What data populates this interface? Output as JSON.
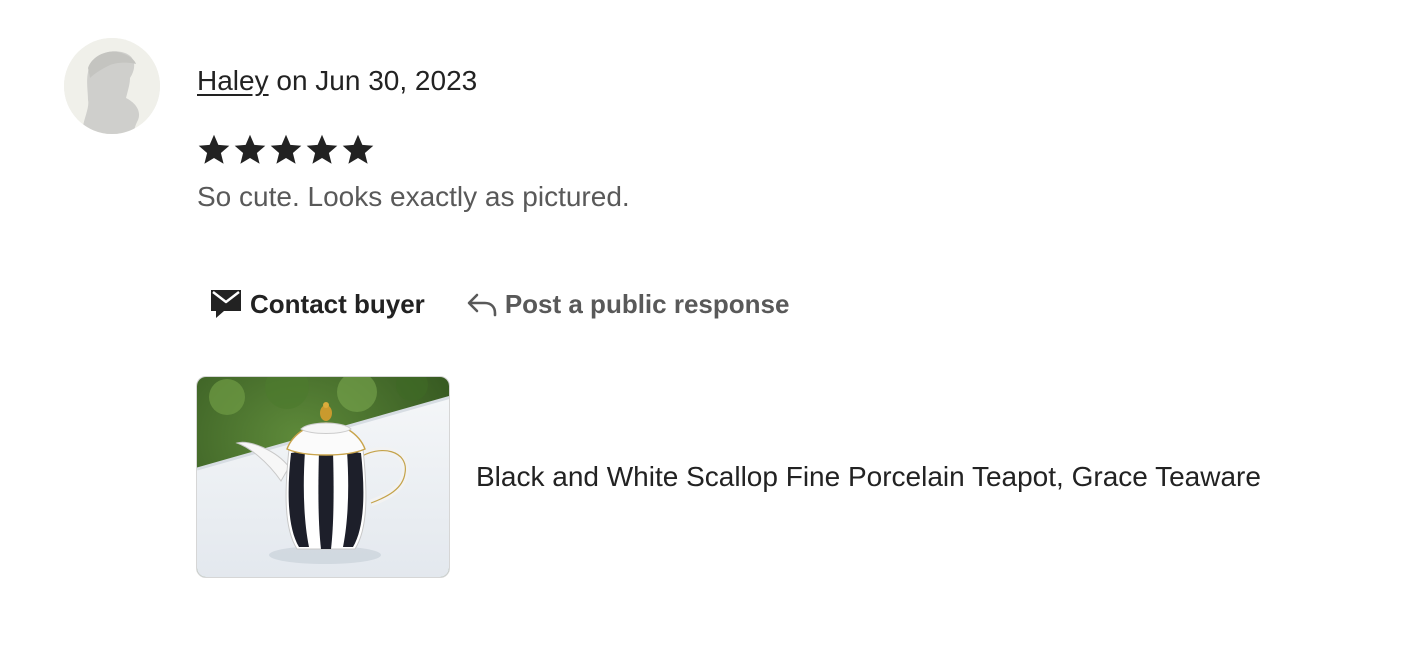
{
  "review": {
    "reviewer_name": "Haley",
    "date_text": "on Jun 30, 2023",
    "rating": 5,
    "rating_max": 5,
    "text": "So cute. Looks exactly as pictured."
  },
  "actions": {
    "contact_label": "Contact buyer",
    "respond_label": "Post a public response"
  },
  "product": {
    "title": "Black and White Scallop Fine Porcelain Teapot, Grace Teaware"
  },
  "icons": {
    "avatar": "default-avatar-icon",
    "star": "star-icon",
    "contact": "envelope-icon",
    "respond": "reply-arrow-icon"
  },
  "colors": {
    "text_primary": "#222222",
    "text_secondary": "#595959",
    "avatar_bg": "#f0f0ea"
  }
}
